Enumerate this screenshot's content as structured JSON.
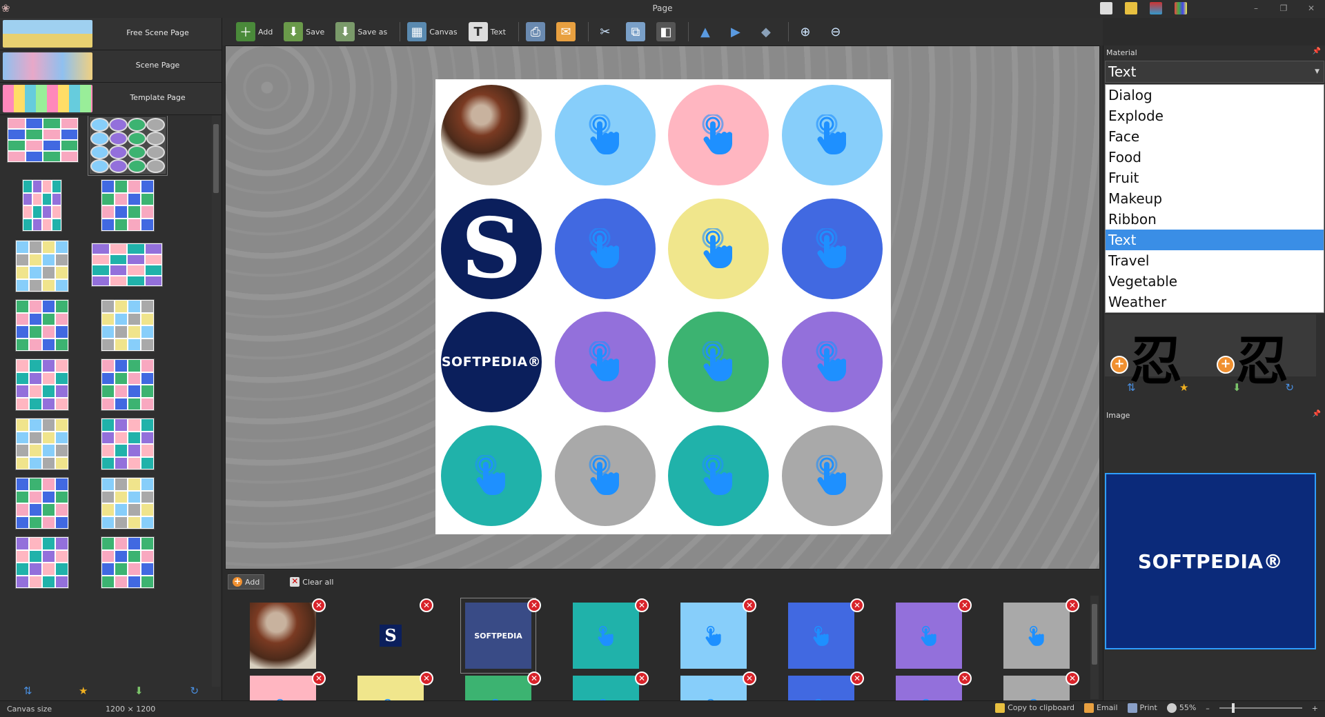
{
  "window": {
    "title": "Page"
  },
  "left": {
    "page_types": [
      {
        "label": "Free Scene Page"
      },
      {
        "label": "Scene Page"
      },
      {
        "label": "Template Page"
      }
    ]
  },
  "toolbar": {
    "add": "Add",
    "save": "Save",
    "save_as": "Save as",
    "canvas": "Canvas",
    "text": "Text"
  },
  "canvas": {
    "cells": [
      {
        "kind": "photo"
      },
      {
        "kind": "hand",
        "color": "#87cefa"
      },
      {
        "kind": "hand",
        "color": "#ffb6c1"
      },
      {
        "kind": "hand",
        "color": "#87cefa"
      },
      {
        "kind": "s-logo",
        "text": "S"
      },
      {
        "kind": "hand",
        "color": "#4169e1"
      },
      {
        "kind": "hand",
        "color": "#f0e68c"
      },
      {
        "kind": "hand",
        "color": "#4169e1"
      },
      {
        "kind": "sp-logo",
        "text": "SOFTPEDIA®"
      },
      {
        "kind": "hand",
        "color": "#9370db"
      },
      {
        "kind": "hand",
        "color": "#3cb371"
      },
      {
        "kind": "hand",
        "color": "#9370db"
      },
      {
        "kind": "hand",
        "color": "#20b2aa"
      },
      {
        "kind": "hand",
        "color": "#a9a9a9"
      },
      {
        "kind": "hand",
        "color": "#20b2aa"
      },
      {
        "kind": "hand",
        "color": "#a9a9a9"
      }
    ]
  },
  "strip": {
    "add_label": "Add",
    "clear_label": "Clear all",
    "thumb_colors": [
      "photo",
      "#ffffff",
      "#394b86",
      "#20b2aa",
      "#87cefa",
      "#4169e1",
      "#9370db",
      "#a9a9a9",
      "#ffb6c1",
      "#f0e68c",
      "#3cb371",
      "#20b2aa",
      "#87cefa",
      "#4169e1",
      "#9370db",
      "#a9a9a9"
    ],
    "s_text": "S",
    "sp_text": "SOFTPEDIA"
  },
  "material": {
    "header": "Material",
    "selected": "Text",
    "options": [
      "Dialog",
      "Explode",
      "Face",
      "Food",
      "Fruit",
      "Makeup",
      "Ribbon",
      "Text",
      "Travel",
      "Vegetable",
      "Weather"
    ],
    "kanji": "忍"
  },
  "image_panel": {
    "header": "Image",
    "preview_text": "SOFTPEDIA®"
  },
  "status": {
    "canvas_size_label": "Canvas size",
    "canvas_size_value": "1200 × 1200",
    "copy": "Copy to clipboard",
    "email": "Email",
    "print": "Print",
    "zoom": "55%"
  }
}
